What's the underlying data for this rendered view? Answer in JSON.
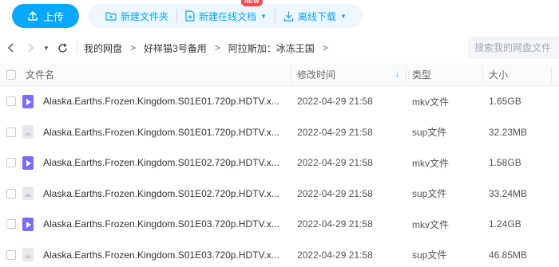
{
  "toolbar": {
    "upload_label": "上传",
    "new_folder_label": "新建文件夹",
    "new_online_doc_label": "新建在线文档",
    "new_badge": "NEW",
    "offline_download_label": "离线下载"
  },
  "nav": {
    "breadcrumbs": [
      "我的网盘",
      "好样猫3号备用",
      "阿拉斯加：冰冻王国"
    ],
    "search_placeholder": "搜索我的网盘文件"
  },
  "table": {
    "headers": {
      "name": "文件名",
      "time": "修改时间",
      "type": "类型",
      "size": "大小"
    },
    "rows": [
      {
        "icon": "video-file-icon",
        "name": "Alaska.Earths.Frozen.Kingdom.S01E01.720p.HDTV.x...",
        "time": "2022-04-29 21:58",
        "type": "mkv文件",
        "size": "1.65GB"
      },
      {
        "icon": "generic-file-icon",
        "name": "Alaska.Earths.Frozen.Kingdom.S01E01.720p.HDTV.x...",
        "time": "2022-04-29 21:58",
        "type": "sup文件",
        "size": "32.23MB"
      },
      {
        "icon": "video-file-icon",
        "name": "Alaska.Earths.Frozen.Kingdom.S01E02.720p.HDTV.x...",
        "time": "2022-04-29 21:58",
        "type": "mkv文件",
        "size": "1.58GB"
      },
      {
        "icon": "generic-file-icon",
        "name": "Alaska.Earths.Frozen.Kingdom.S01E02.720p.HDTV.x...",
        "time": "2022-04-29 21:58",
        "type": "sup文件",
        "size": "33.24MB"
      },
      {
        "icon": "video-file-icon",
        "name": "Alaska.Earths.Frozen.Kingdom.S01E03.720p.HDTV.x...",
        "time": "2022-04-29 21:58",
        "type": "mkv文件",
        "size": "1.24GB"
      },
      {
        "icon": "generic-file-icon",
        "name": "Alaska.Earths.Frozen.Kingdom.S01E03.720p.HDTV.x...",
        "time": "2022-04-29 21:58",
        "type": "sup文件",
        "size": "46.85MB"
      }
    ]
  },
  "colors": {
    "accent": "#06a7ff",
    "badge": "#f5484f",
    "video_icon": "#7d6dff"
  }
}
